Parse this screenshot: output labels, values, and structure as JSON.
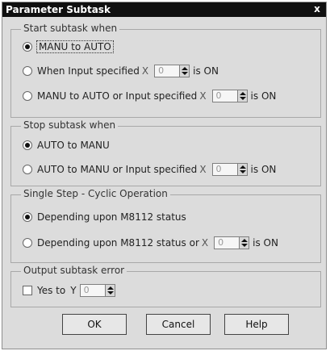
{
  "title": "Parameter Subtask",
  "close_glyph": "x",
  "groups": {
    "start": {
      "label": "Start subtask when",
      "options": [
        {
          "text": "MANU to AUTO"
        },
        {
          "text": "When Input specified",
          "spin_value": "0",
          "suffix": "is ON"
        },
        {
          "text": "MANU to AUTO or Input specified",
          "spin_value": "0",
          "suffix": "is ON"
        }
      ]
    },
    "stop": {
      "label": "Stop subtask when",
      "options": [
        {
          "text": "AUTO to MANU"
        },
        {
          "text": "AUTO to MANU or Input specified",
          "spin_value": "0",
          "suffix": "is ON"
        }
      ]
    },
    "single": {
      "label": "Single Step - Cyclic Operation",
      "options": [
        {
          "text": "Depending upon M8112 status"
        },
        {
          "text": "Depending upon M8112 status or",
          "spin_value": "0",
          "suffix": "is ON"
        }
      ]
    },
    "output": {
      "label": "Output subtask error",
      "checkbox_text": "Yes to",
      "y_label": "Y",
      "spin_value": "0"
    }
  },
  "x_glyph": "X",
  "buttons": {
    "ok": "OK",
    "cancel": "Cancel",
    "help": "Help"
  }
}
